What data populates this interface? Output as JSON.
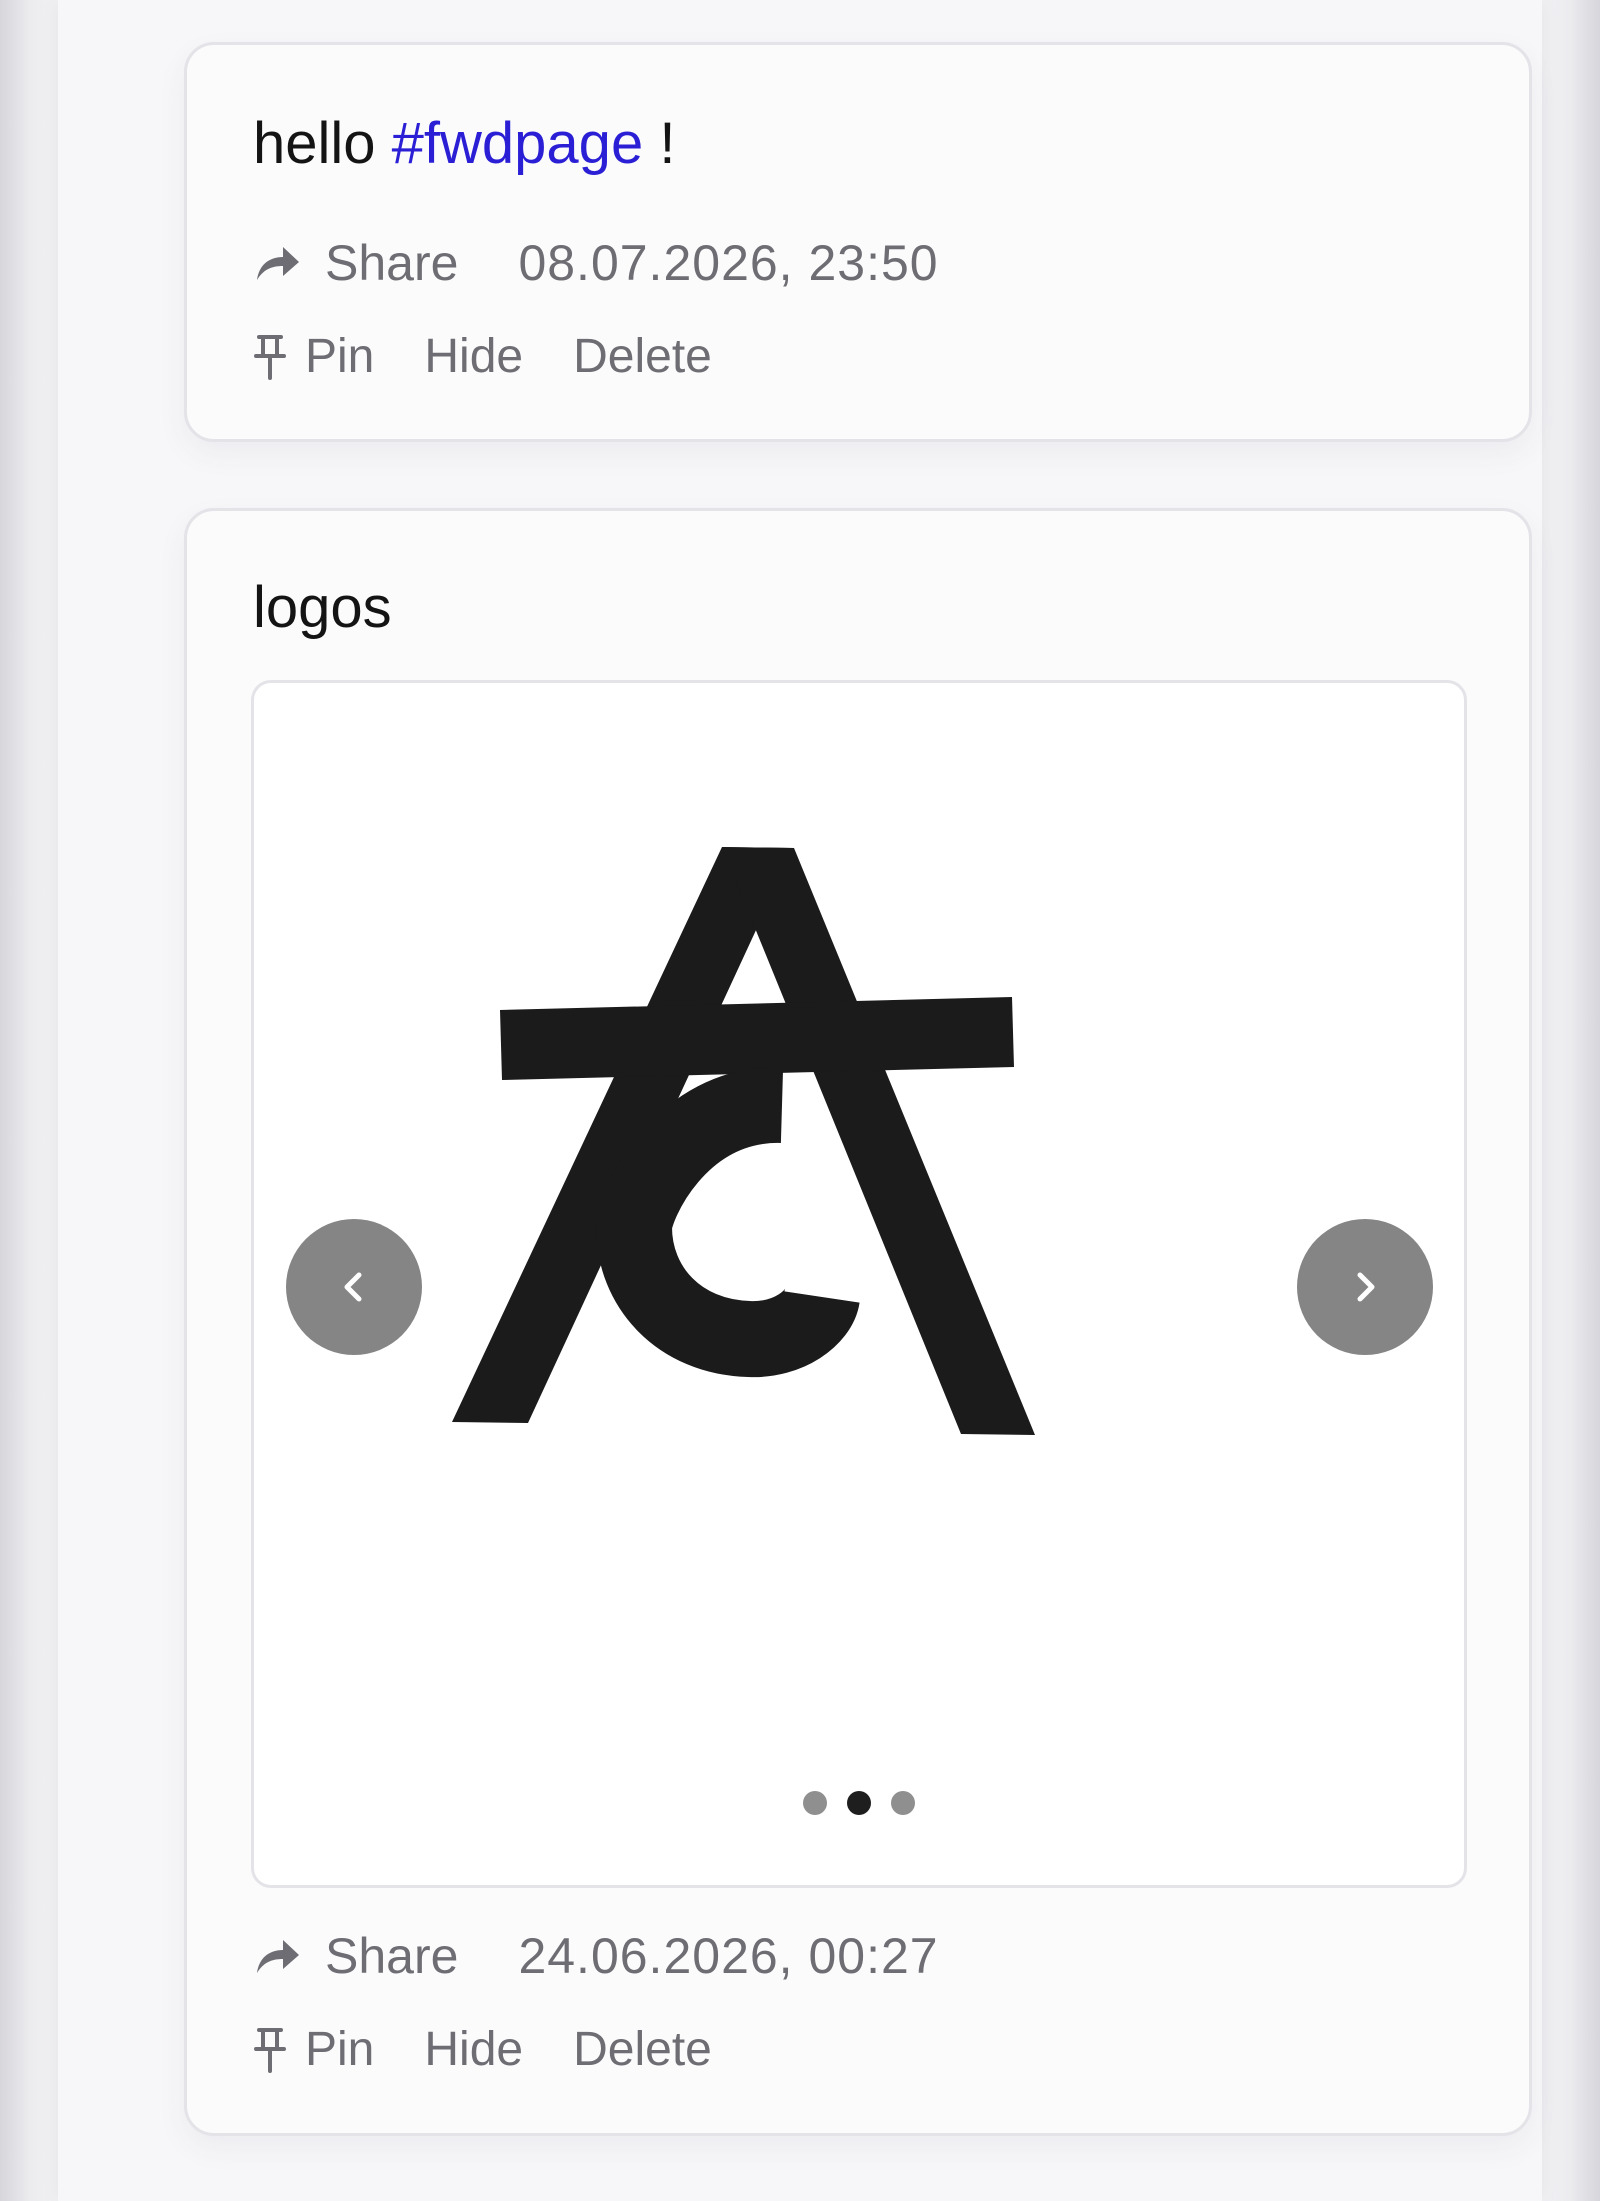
{
  "posts": [
    {
      "text_prefix": "hello ",
      "hashtag": "#fwdpage",
      "text_suffix": " !",
      "share_label": "Share",
      "timestamp": "08.07.2026, 23:50",
      "pin_label": "Pin",
      "hide_label": "Hide",
      "delete_label": "Delete"
    },
    {
      "title": "logos",
      "share_label": "Share",
      "timestamp": "24.06.2026, 00:27",
      "pin_label": "Pin",
      "hide_label": "Hide",
      "delete_label": "Delete",
      "carousel": {
        "slide_count": 3,
        "active_index": 1,
        "prev_icon": "chevron-left-icon",
        "next_icon": "chevron-right-icon"
      }
    }
  ],
  "colors": {
    "hashtag": "#2b1fd6",
    "meta_text": "#6d6d73",
    "nav_button": "#858585",
    "dot_active": "#1e1e1e",
    "dot_inactive": "#8f8f8f"
  },
  "icons": {
    "share": "share-arrow-icon",
    "pin": "pin-icon"
  }
}
